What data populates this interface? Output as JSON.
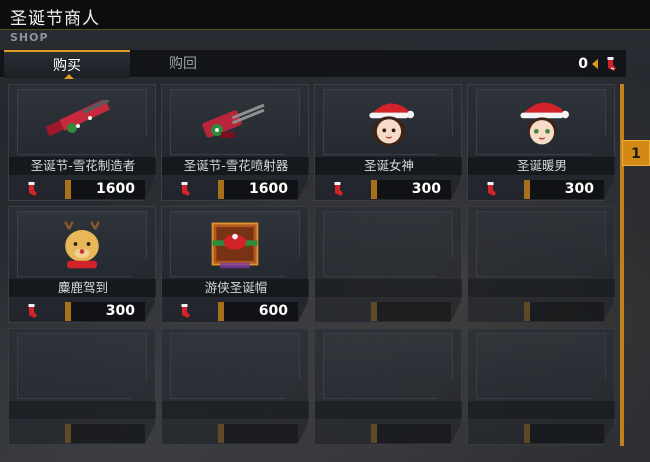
{
  "header": {
    "title": "圣诞节商人",
    "subtitle": "SHOP"
  },
  "tabs": [
    {
      "label": "购买",
      "active": true
    },
    {
      "label": "购回",
      "active": false
    }
  ],
  "currency": {
    "amount": "0",
    "icon": "christmas-sock-icon"
  },
  "page": "1",
  "items": [
    {
      "name": "圣诞节-雪花制造者",
      "price": "1600",
      "icon": "christmas-rifle-icon"
    },
    {
      "name": "圣诞节-雪花喷射器",
      "price": "1600",
      "icon": "christmas-minigun-icon"
    },
    {
      "name": "圣诞女神",
      "price": "300",
      "icon": "santa-girl-avatar-icon"
    },
    {
      "name": "圣诞暖男",
      "price": "300",
      "icon": "santa-boy-avatar-icon"
    },
    {
      "name": "麋鹿驾到",
      "price": "300",
      "icon": "reindeer-avatar-icon"
    },
    {
      "name": "游侠圣诞帽",
      "price": "600",
      "icon": "christmas-hat-crate-icon"
    }
  ],
  "empty_slots": 6,
  "colors": {
    "accent": "#e09a20",
    "panel": "#22252b",
    "sock_red": "#d2232a"
  }
}
